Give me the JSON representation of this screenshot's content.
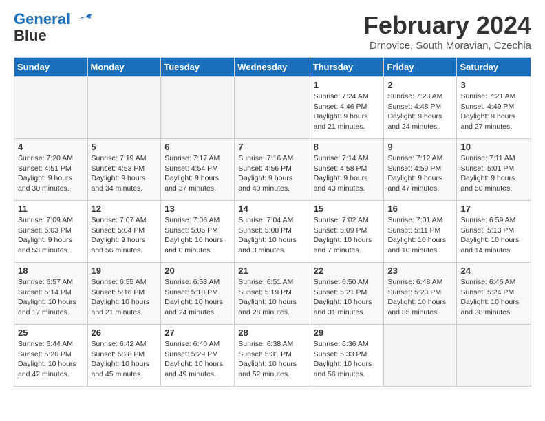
{
  "logo": {
    "line1": "General",
    "line2": "Blue"
  },
  "header": {
    "month": "February 2024",
    "location": "Drnovice, South Moravian, Czechia"
  },
  "days_of_week": [
    "Sunday",
    "Monday",
    "Tuesday",
    "Wednesday",
    "Thursday",
    "Friday",
    "Saturday"
  ],
  "weeks": [
    [
      {
        "day": "",
        "info": ""
      },
      {
        "day": "",
        "info": ""
      },
      {
        "day": "",
        "info": ""
      },
      {
        "day": "",
        "info": ""
      },
      {
        "day": "1",
        "info": "Sunrise: 7:24 AM\nSunset: 4:46 PM\nDaylight: 9 hours\nand 21 minutes."
      },
      {
        "day": "2",
        "info": "Sunrise: 7:23 AM\nSunset: 4:48 PM\nDaylight: 9 hours\nand 24 minutes."
      },
      {
        "day": "3",
        "info": "Sunrise: 7:21 AM\nSunset: 4:49 PM\nDaylight: 9 hours\nand 27 minutes."
      }
    ],
    [
      {
        "day": "4",
        "info": "Sunrise: 7:20 AM\nSunset: 4:51 PM\nDaylight: 9 hours\nand 30 minutes."
      },
      {
        "day": "5",
        "info": "Sunrise: 7:19 AM\nSunset: 4:53 PM\nDaylight: 9 hours\nand 34 minutes."
      },
      {
        "day": "6",
        "info": "Sunrise: 7:17 AM\nSunset: 4:54 PM\nDaylight: 9 hours\nand 37 minutes."
      },
      {
        "day": "7",
        "info": "Sunrise: 7:16 AM\nSunset: 4:56 PM\nDaylight: 9 hours\nand 40 minutes."
      },
      {
        "day": "8",
        "info": "Sunrise: 7:14 AM\nSunset: 4:58 PM\nDaylight: 9 hours\nand 43 minutes."
      },
      {
        "day": "9",
        "info": "Sunrise: 7:12 AM\nSunset: 4:59 PM\nDaylight: 9 hours\nand 47 minutes."
      },
      {
        "day": "10",
        "info": "Sunrise: 7:11 AM\nSunset: 5:01 PM\nDaylight: 9 hours\nand 50 minutes."
      }
    ],
    [
      {
        "day": "11",
        "info": "Sunrise: 7:09 AM\nSunset: 5:03 PM\nDaylight: 9 hours\nand 53 minutes."
      },
      {
        "day": "12",
        "info": "Sunrise: 7:07 AM\nSunset: 5:04 PM\nDaylight: 9 hours\nand 56 minutes."
      },
      {
        "day": "13",
        "info": "Sunrise: 7:06 AM\nSunset: 5:06 PM\nDaylight: 10 hours\nand 0 minutes."
      },
      {
        "day": "14",
        "info": "Sunrise: 7:04 AM\nSunset: 5:08 PM\nDaylight: 10 hours\nand 3 minutes."
      },
      {
        "day": "15",
        "info": "Sunrise: 7:02 AM\nSunset: 5:09 PM\nDaylight: 10 hours\nand 7 minutes."
      },
      {
        "day": "16",
        "info": "Sunrise: 7:01 AM\nSunset: 5:11 PM\nDaylight: 10 hours\nand 10 minutes."
      },
      {
        "day": "17",
        "info": "Sunrise: 6:59 AM\nSunset: 5:13 PM\nDaylight: 10 hours\nand 14 minutes."
      }
    ],
    [
      {
        "day": "18",
        "info": "Sunrise: 6:57 AM\nSunset: 5:14 PM\nDaylight: 10 hours\nand 17 minutes."
      },
      {
        "day": "19",
        "info": "Sunrise: 6:55 AM\nSunset: 5:16 PM\nDaylight: 10 hours\nand 21 minutes."
      },
      {
        "day": "20",
        "info": "Sunrise: 6:53 AM\nSunset: 5:18 PM\nDaylight: 10 hours\nand 24 minutes."
      },
      {
        "day": "21",
        "info": "Sunrise: 6:51 AM\nSunset: 5:19 PM\nDaylight: 10 hours\nand 28 minutes."
      },
      {
        "day": "22",
        "info": "Sunrise: 6:50 AM\nSunset: 5:21 PM\nDaylight: 10 hours\nand 31 minutes."
      },
      {
        "day": "23",
        "info": "Sunrise: 6:48 AM\nSunset: 5:23 PM\nDaylight: 10 hours\nand 35 minutes."
      },
      {
        "day": "24",
        "info": "Sunrise: 6:46 AM\nSunset: 5:24 PM\nDaylight: 10 hours\nand 38 minutes."
      }
    ],
    [
      {
        "day": "25",
        "info": "Sunrise: 6:44 AM\nSunset: 5:26 PM\nDaylight: 10 hours\nand 42 minutes."
      },
      {
        "day": "26",
        "info": "Sunrise: 6:42 AM\nSunset: 5:28 PM\nDaylight: 10 hours\nand 45 minutes."
      },
      {
        "day": "27",
        "info": "Sunrise: 6:40 AM\nSunset: 5:29 PM\nDaylight: 10 hours\nand 49 minutes."
      },
      {
        "day": "28",
        "info": "Sunrise: 6:38 AM\nSunset: 5:31 PM\nDaylight: 10 hours\nand 52 minutes."
      },
      {
        "day": "29",
        "info": "Sunrise: 6:36 AM\nSunset: 5:33 PM\nDaylight: 10 hours\nand 56 minutes."
      },
      {
        "day": "",
        "info": ""
      },
      {
        "day": "",
        "info": ""
      }
    ]
  ]
}
